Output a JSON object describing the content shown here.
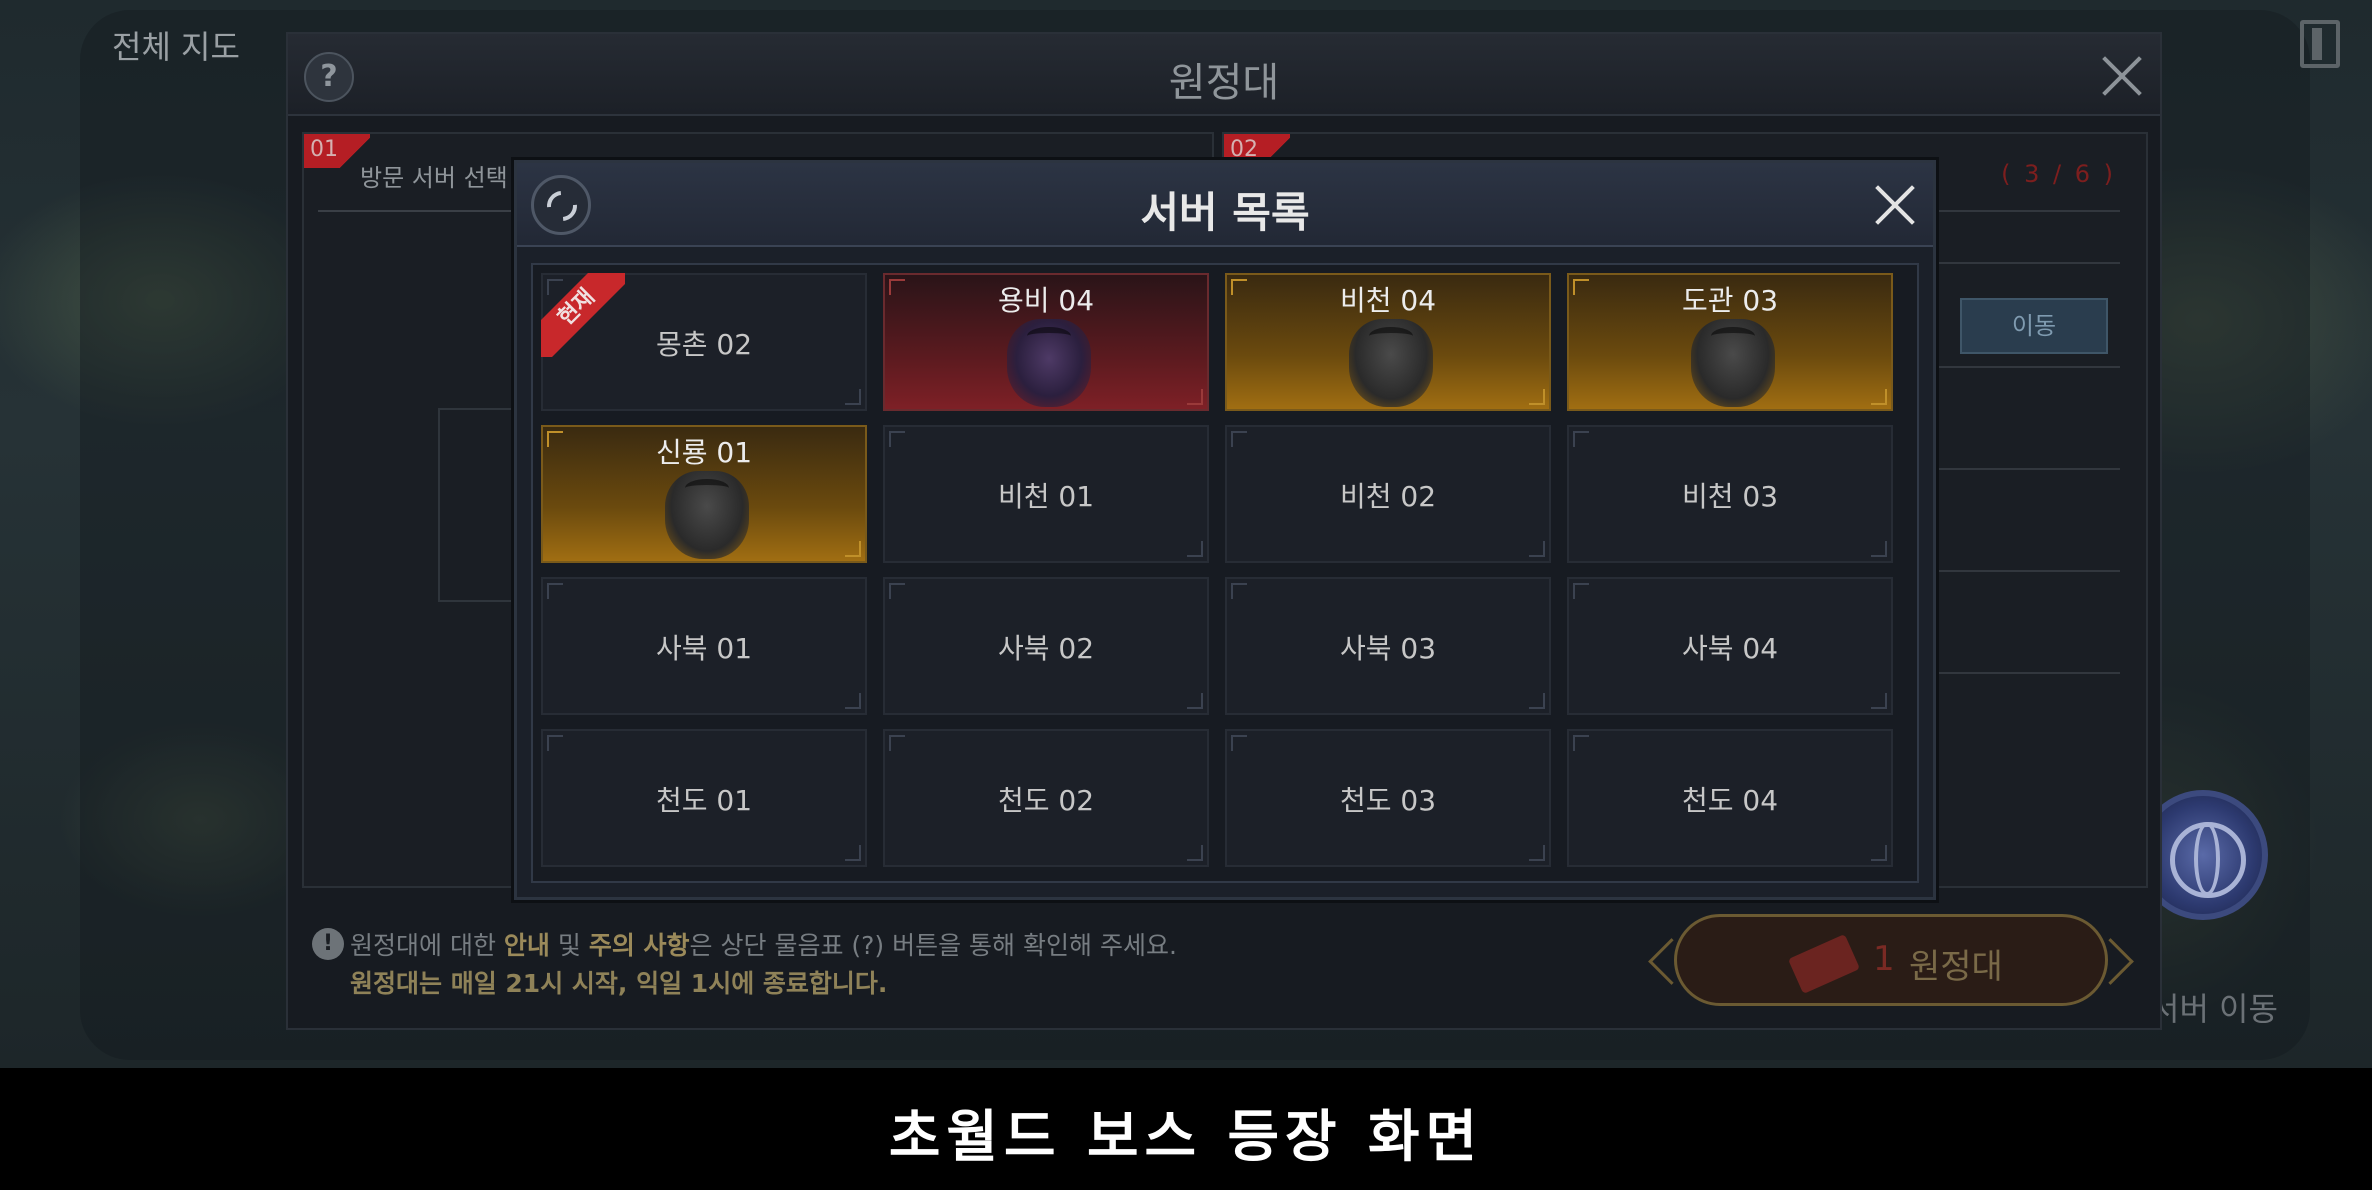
{
  "map": {
    "title": "전체 지도"
  },
  "expedition": {
    "title": "원정대",
    "help_glyph": "?",
    "step1": {
      "badge": "01",
      "title": "방문 서버 선택"
    },
    "step2": {
      "badge": "02",
      "count": "( 3 / 6 )",
      "move_button": "이동"
    },
    "notice": {
      "icon": "!",
      "line1_pre": "원정대에 대한 ",
      "line1_hl1": "안내",
      "line1_mid": " 및 ",
      "line1_hl2": "주의 사항",
      "line1_post": "은 상단 물음표 (?) 버튼을 통해 확인해 주세요.",
      "line2": "원정대는 매일 21시 시작, 익일 1시에 종료합니다."
    },
    "action_button": {
      "count": "1",
      "label": "원정대"
    },
    "server_move_label": "서버 이동"
  },
  "server_list": {
    "title": "서버 목록",
    "current_badge": "현재",
    "rows": [
      [
        {
          "name": "몽촌 02",
          "state": "current"
        },
        {
          "name": "용비 04",
          "state": "boss-red"
        },
        {
          "name": "비천 04",
          "state": "boss-gold"
        },
        {
          "name": "도관 03",
          "state": "boss-gold"
        }
      ],
      [
        {
          "name": "신룡 01",
          "state": "boss-gold"
        },
        {
          "name": "비천 01",
          "state": "normal"
        },
        {
          "name": "비천 02",
          "state": "normal"
        },
        {
          "name": "비천 03",
          "state": "normal"
        }
      ],
      [
        {
          "name": "사북 01",
          "state": "normal"
        },
        {
          "name": "사북 02",
          "state": "normal"
        },
        {
          "name": "사북 03",
          "state": "normal"
        },
        {
          "name": "사북 04",
          "state": "normal"
        }
      ],
      [
        {
          "name": "천도 01",
          "state": "normal"
        },
        {
          "name": "천도 02",
          "state": "normal"
        },
        {
          "name": "천도 03",
          "state": "normal"
        },
        {
          "name": "천도 04",
          "state": "normal"
        }
      ]
    ]
  },
  "caption": "초월드 보스 등장 화면",
  "colors": {
    "boss_gold": "#a06e12",
    "boss_red": "#7e2026",
    "current_ribbon": "#c8282b"
  }
}
